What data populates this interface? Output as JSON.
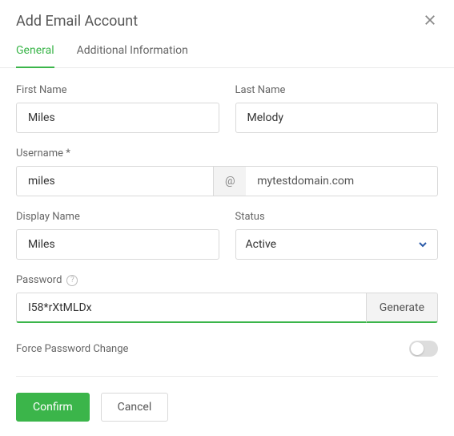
{
  "dialog": {
    "title": "Add Email Account"
  },
  "tabs": {
    "general": "General",
    "additional": "Additional Information"
  },
  "fields": {
    "firstName": {
      "label": "First Name",
      "value": "Miles"
    },
    "lastName": {
      "label": "Last Name",
      "value": "Melody"
    },
    "username": {
      "label": "Username *",
      "value": "miles",
      "at": "@",
      "domain": "mytestdomain.com"
    },
    "displayName": {
      "label": "Display Name",
      "value": "Miles"
    },
    "status": {
      "label": "Status",
      "value": "Active"
    },
    "password": {
      "label": "Password",
      "value": "I58*rXtMLDx",
      "generate": "Generate"
    },
    "forcePassword": {
      "label": "Force Password Change",
      "on": false
    }
  },
  "footer": {
    "confirm": "Confirm",
    "cancel": "Cancel"
  },
  "colors": {
    "accent": "#3bb54a"
  }
}
